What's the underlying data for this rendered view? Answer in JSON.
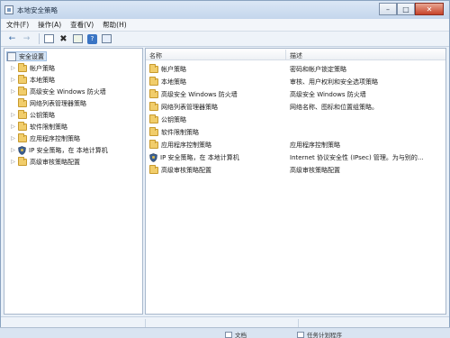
{
  "window": {
    "title": "本地安全策略"
  },
  "menu": [
    "文件(F)",
    "操作(A)",
    "查看(V)",
    "帮助(H)"
  ],
  "toolbar": {
    "icons": [
      "back-arrow-icon",
      "forward-arrow-icon",
      "show-hide-tree-icon",
      "delete-icon",
      "export-list-icon",
      "help-icon",
      "properties-icon"
    ]
  },
  "tree": {
    "root": "安全设置",
    "items": [
      {
        "label": "帐户策略",
        "icon": "folder-icon",
        "expandable": true
      },
      {
        "label": "本地策略",
        "icon": "folder-icon",
        "expandable": true
      },
      {
        "label": "高级安全 Windows 防火墙",
        "icon": "folder-icon",
        "expandable": true
      },
      {
        "label": "网络列表管理器策略",
        "icon": "folder-icon",
        "expandable": false
      },
      {
        "label": "公钥策略",
        "icon": "folder-icon",
        "expandable": true
      },
      {
        "label": "软件限制策略",
        "icon": "folder-icon",
        "expandable": true
      },
      {
        "label": "应用程序控制策略",
        "icon": "folder-icon",
        "expandable": true
      },
      {
        "label": "IP 安全策略，在 本地计算机",
        "icon": "shield-icon",
        "expandable": true
      },
      {
        "label": "高级审核策略配置",
        "icon": "folder-icon",
        "expandable": true
      }
    ]
  },
  "list": {
    "columns": {
      "name": "名称",
      "description": "描述"
    },
    "rows": [
      {
        "name": "帐户策略",
        "description": "密码和帐户锁定策略",
        "icon": "folder-icon"
      },
      {
        "name": "本地策略",
        "description": "审核、用户权利和安全选项策略",
        "icon": "folder-icon"
      },
      {
        "name": "高级安全 Windows 防火墙",
        "description": "高级安全 Windows 防火墙",
        "icon": "folder-icon"
      },
      {
        "name": "网络列表管理器策略",
        "description": "网络名称、图标和位置组策略。",
        "icon": "folder-icon"
      },
      {
        "name": "公钥策略",
        "description": "",
        "icon": "folder-icon"
      },
      {
        "name": "软件限制策略",
        "description": "",
        "icon": "folder-icon"
      },
      {
        "name": "应用程序控制策略",
        "description": "应用程序控制策略",
        "icon": "folder-icon"
      },
      {
        "name": "IP 安全策略，在 本地计算机",
        "description": "Internet 协议安全性 (IPsec) 管理。为与别的...",
        "icon": "shield-icon"
      },
      {
        "name": "高级审核策略配置",
        "description": "高级审核策略配置",
        "icon": "folder-icon"
      }
    ]
  },
  "taskbar": {
    "item1": "文档",
    "item2": "任务计划程序"
  }
}
